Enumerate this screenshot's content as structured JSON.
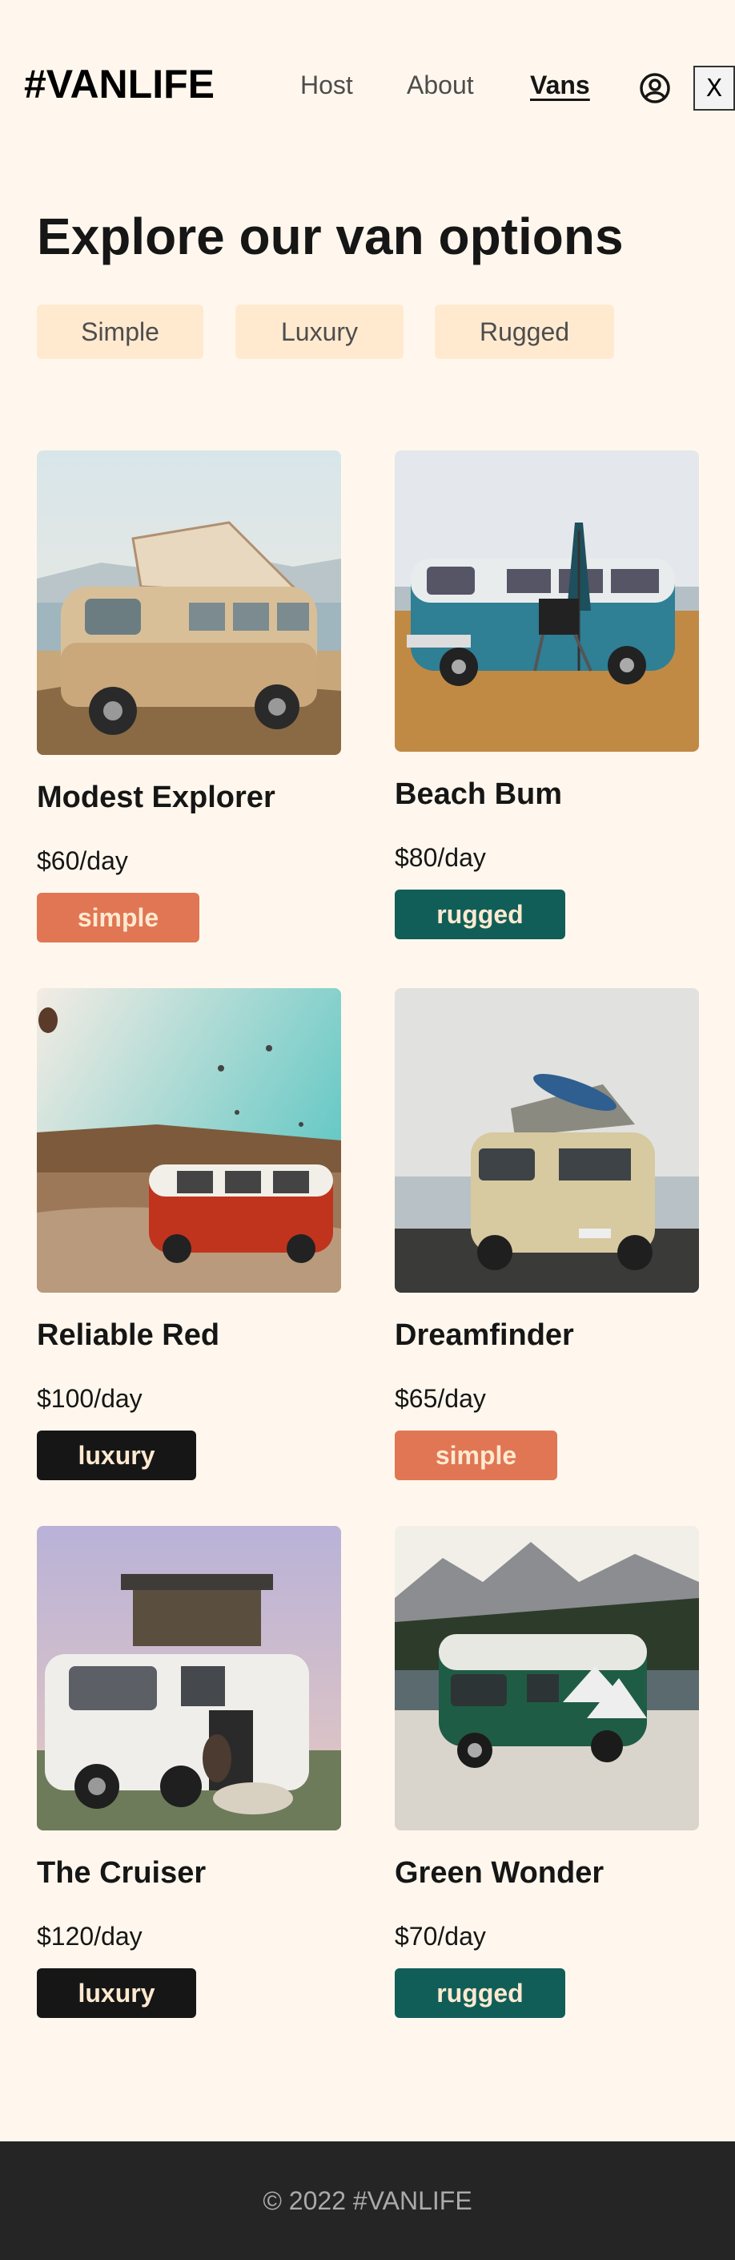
{
  "header": {
    "logo": "#VANLIFE",
    "nav": {
      "host": "Host",
      "about": "About",
      "vans": "Vans"
    },
    "avatar_icon": "user-circle-icon",
    "close_label": "X"
  },
  "main": {
    "title": "Explore our van options",
    "filters": [
      "Simple",
      "Luxury",
      "Rugged"
    ]
  },
  "vans": [
    {
      "name": "Modest Explorer",
      "price": "$60/day",
      "type": "simple"
    },
    {
      "name": "Beach Bum",
      "price": "$80/day",
      "type": "rugged"
    },
    {
      "name": "Reliable Red",
      "price": "$100/day",
      "type": "luxury"
    },
    {
      "name": "Dreamfinder",
      "price": "$65/day",
      "type": "simple"
    },
    {
      "name": "The Cruiser",
      "price": "$120/day",
      "type": "luxury"
    },
    {
      "name": "Green Wonder",
      "price": "$70/day",
      "type": "rugged"
    }
  ],
  "colors": {
    "background": "#FFF7ED",
    "filter_bg": "#FFEAD0",
    "simple": "#E17654",
    "rugged": "#115E59",
    "luxury": "#161616",
    "footer_bg": "#252525"
  },
  "footer": {
    "copyright": "© 2022 #VANLIFE"
  }
}
